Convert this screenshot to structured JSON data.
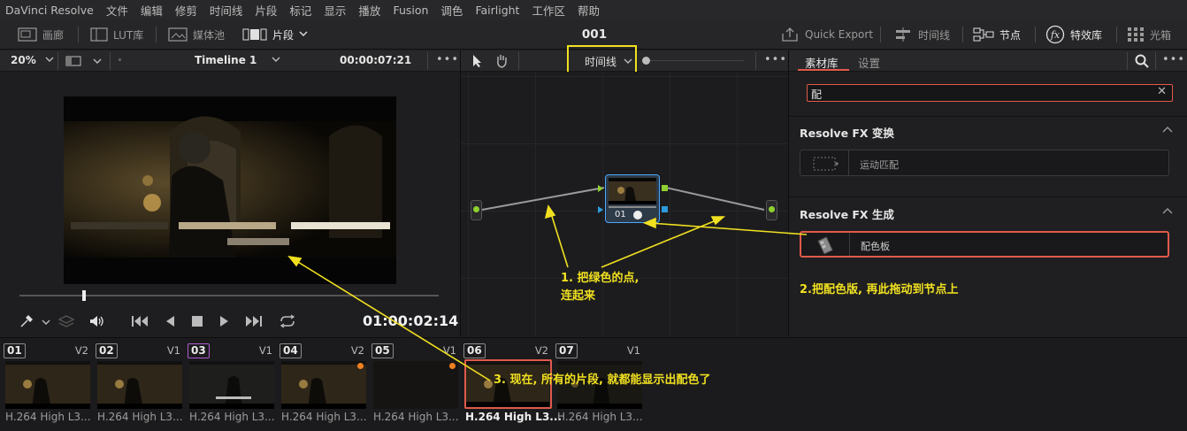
{
  "menubar": {
    "items": [
      "DaVinci Resolve",
      "文件",
      "编辑",
      "修剪",
      "时间线",
      "片段",
      "标记",
      "显示",
      "播放",
      "Fusion",
      "调色",
      "Fairlight",
      "工作区",
      "帮助"
    ]
  },
  "toolbar": {
    "gallery": "画廊",
    "lut": "LUT库",
    "media_pool": "媒体池",
    "clips": "片段",
    "title": "001",
    "quick_export": "Quick Export",
    "timeline": "时间线",
    "nodes": "节点",
    "effects": "特效库",
    "lightbox": "光箱"
  },
  "viewer": {
    "zoom": "20%",
    "timeline_name": "Timeline 1",
    "timecode_top": "00:00:07:21",
    "timecode": "01:00:02:14",
    "scrubber_progress": 0.15
  },
  "nodes": {
    "mode_label": "时间线",
    "node_label": "01"
  },
  "library": {
    "tab_library": "素材库",
    "tab_settings": "设置",
    "search_value": "配",
    "section1_title": "Resolve FX 变换",
    "section1_item": "运动匹配",
    "section2_title": "Resolve FX 生成",
    "section2_item": "配色板"
  },
  "annotations": {
    "note1_line1": "1. 把绿色的点,",
    "note1_line2": "连起来",
    "note2": "2.把配色版, 再此拖动到节点上",
    "note3": "3. 现在, 所有的片段, 就都能显示出配色了"
  },
  "clips": [
    {
      "num": "01",
      "track": "V2",
      "caption": "H.264 High L3...",
      "dot": false,
      "selected": false,
      "num_color": "#8a8a8a"
    },
    {
      "num": "02",
      "track": "V1",
      "caption": "H.264 High L3...",
      "dot": false,
      "selected": false,
      "num_color": "#8a8a8a"
    },
    {
      "num": "03",
      "track": "V1",
      "caption": "H.264 High L3...",
      "dot": false,
      "selected": false,
      "num_color": "#b05ad0"
    },
    {
      "num": "04",
      "track": "V2",
      "caption": "H.264 High L3...",
      "dot": true,
      "selected": false,
      "num_color": "#8a8a8a"
    },
    {
      "num": "05",
      "track": "V1",
      "caption": "H.264 High L3...",
      "dot": true,
      "selected": false,
      "num_color": "#8a8a8a"
    },
    {
      "num": "06",
      "track": "V2",
      "caption": "H.264 High L3...",
      "dot": false,
      "selected": true,
      "num_color": "#8a8a8a"
    },
    {
      "num": "07",
      "track": "V1",
      "caption": "H.264 High L3...",
      "dot": false,
      "selected": false,
      "num_color": "#8a8a8a"
    }
  ],
  "colors": {
    "accent_red": "#e05a4a",
    "annotation_yellow": "#f0e020",
    "node_green": "#8fd030",
    "node_blue": "#2c9bdc"
  }
}
